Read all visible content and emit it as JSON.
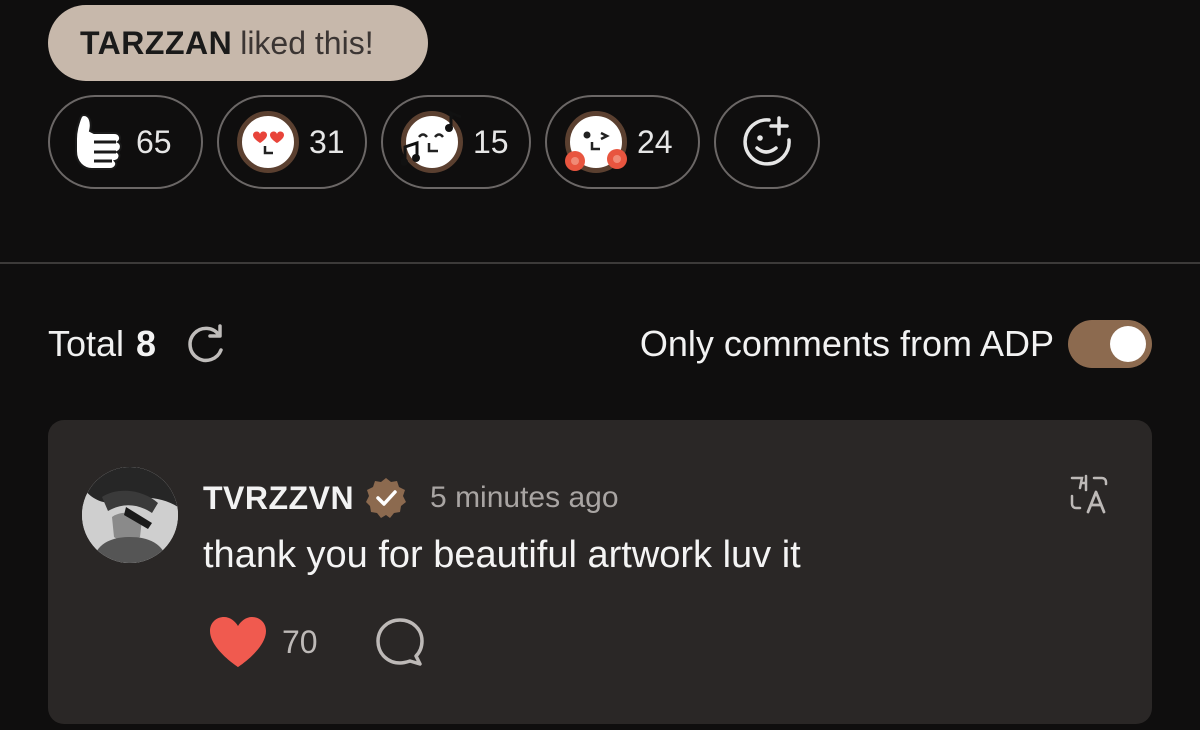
{
  "liked_banner": {
    "user": "TARZZAN",
    "suffix": "liked this!"
  },
  "reactions": [
    {
      "name": "thumbs-up",
      "count": "65"
    },
    {
      "name": "heart-eyes",
      "count": "31"
    },
    {
      "name": "music-notes",
      "count": "15"
    },
    {
      "name": "cheer-pompoms",
      "count": "24"
    },
    {
      "name": "add-reaction"
    }
  ],
  "comments_header": {
    "total_label": "Total",
    "total_count": "8",
    "filter_label": "Only comments from ADP",
    "filter_on": true
  },
  "comment": {
    "author": "TVRZZVN",
    "verified": true,
    "timestamp": "5 minutes ago",
    "text": "thank you for beautiful artwork luv it",
    "likes": "70"
  },
  "colors": {
    "accent": "#8c6a4f",
    "liked_pill": "#c7b8ab",
    "heart": "#f05a4f",
    "card": "#2a2726"
  }
}
